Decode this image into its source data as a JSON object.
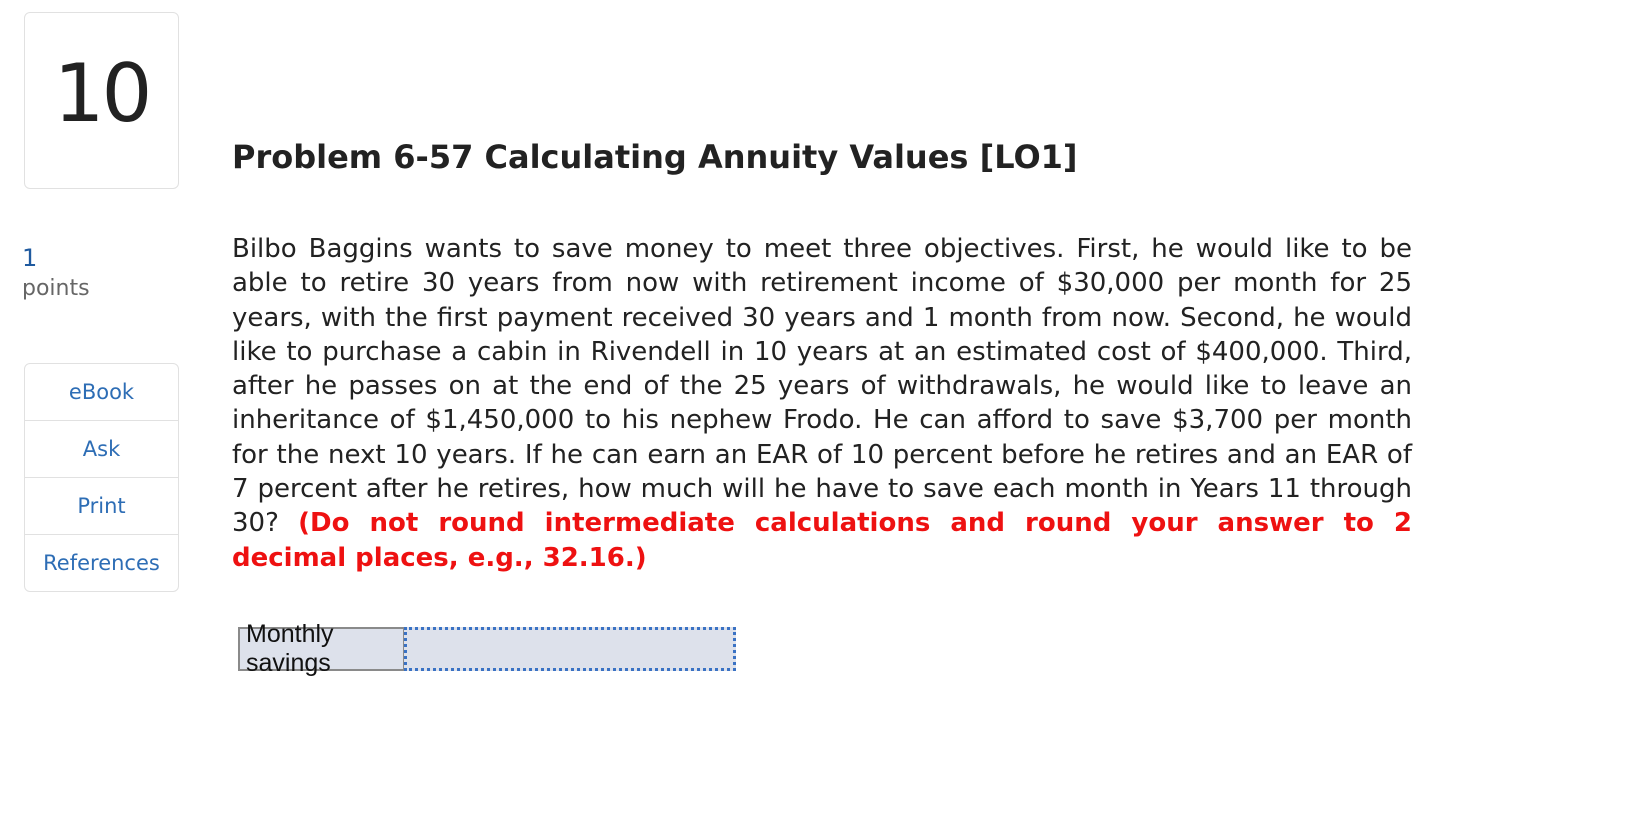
{
  "question": {
    "number": "10",
    "points_value": "1",
    "points_label": "points"
  },
  "resources": [
    {
      "label": "eBook"
    },
    {
      "label": "Ask"
    },
    {
      "label": "Print"
    },
    {
      "label": "References"
    }
  ],
  "problem": {
    "title": "Problem 6-57 Calculating Annuity Values [LO1]",
    "body": "Bilbo Baggins wants to save money to meet three objectives. First, he would like to be able to retire 30 years from now with retirement income of $30,000 per month for 25 years, with the first payment received 30 years and 1 month from now. Second, he would like to purchase a cabin in Rivendell in 10 years at an estimated cost of $400,000. Third, after he passes on at the end of the 25 years of withdrawals, he would like to leave an inheritance of $1,450,000 to his nephew Frodo. He can afford to save $3,700 per month for the next 10 years. If he can earn an EAR of 10 percent before he retires and an EAR of 7 percent after he retires, how much will he have to save each month in Years 11 through 30?",
    "instruction": "(Do not round intermediate calculations and round your answer to 2 decimal places, e.g., 32.16.)"
  },
  "answer": {
    "label": "Monthly savings",
    "value": ""
  },
  "colors": {
    "instruction_red": "#ee1111",
    "link_blue": "#2d6db5",
    "input_bg": "#dde1eb"
  }
}
